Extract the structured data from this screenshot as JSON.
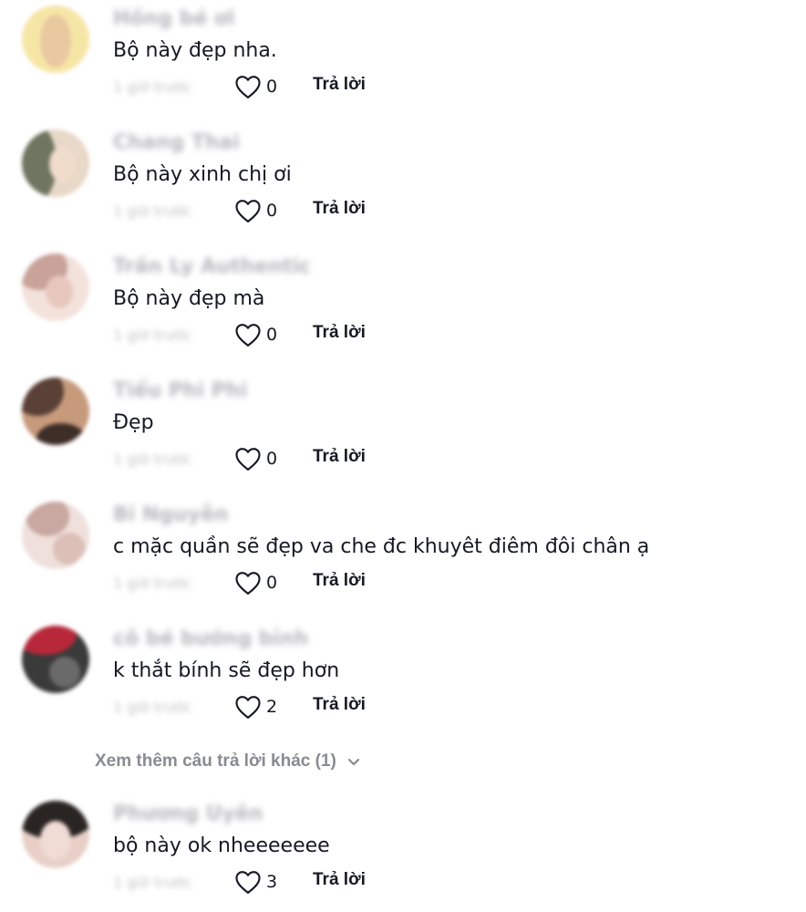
{
  "comments": [
    {
      "username": "Hồng bé ơi",
      "text": "Bộ này đẹp nha.",
      "timestamp": "1 giờ trước",
      "like_count": "0",
      "reply_label": "Trả lời",
      "avatar_colors": [
        "#f6e6a6",
        "#e9c9a0"
      ]
    },
    {
      "username": "Chang Thai",
      "text": "Bộ này xinh chị ơi",
      "timestamp": "1 giờ trước",
      "like_count": "0",
      "reply_label": "Trả lời",
      "avatar_colors": [
        "#6f7560",
        "#e8d8c8"
      ]
    },
    {
      "username": "Trần Ly Authentic",
      "text": "Bộ này đẹp mà",
      "timestamp": "1 giờ trước",
      "like_count": "0",
      "reply_label": "Trả lời",
      "avatar_colors": [
        "#c9a29a",
        "#f3e2dc"
      ]
    },
    {
      "username": "Tiểu Phi Phi",
      "text": "Đẹp",
      "timestamp": "1 giờ trước",
      "like_count": "0",
      "reply_label": "Trả lời",
      "avatar_colors": [
        "#5a4036",
        "#c79a7c"
      ]
    },
    {
      "username": "Bi Nguyễn",
      "text": "c mặc quần sẽ đẹp va che đc khuyêt điêm đôi chân ạ",
      "timestamp": "1 giờ trước",
      "like_count": "0",
      "reply_label": "Trả lời",
      "avatar_colors": [
        "#c8a8a0",
        "#efe0dc"
      ]
    },
    {
      "username": "cô bé bướng bỉnh",
      "text": "k thắt bính sẽ đẹp hơn",
      "timestamp": "1 giờ trước",
      "like_count": "2",
      "reply_label": "Trả lời",
      "avatar_colors": [
        "#b8283a",
        "#3a3a3a"
      ]
    },
    {
      "username": "Phương Uyên",
      "text": "bộ này ok nheeeeeee",
      "timestamp": "1 giờ trước",
      "like_count": "3",
      "reply_label": "Trả lời",
      "avatar_colors": [
        "#2a2422",
        "#e8d0c8"
      ]
    }
  ],
  "view_more": {
    "label": "Xem thêm câu trả lời khác (1)",
    "icon": "chevron-down-icon"
  },
  "colors": {
    "text": "#161823",
    "muted": "#8a8b91",
    "blurred_name": "#b9b9bf"
  }
}
